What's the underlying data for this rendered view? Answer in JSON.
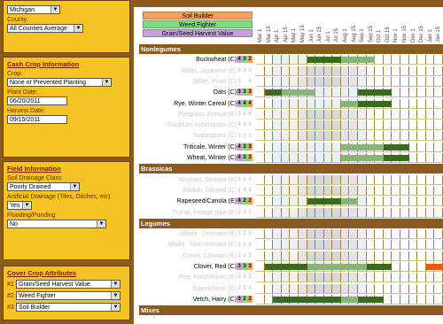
{
  "left": {
    "state": "Michigan",
    "county_label": "County:",
    "county": "All Counties Average",
    "cash_crop_title": "Cash Crop Information",
    "crop_label": "Crop:",
    "crop": "None or Prevented Planting",
    "plant_date_label": "Plant Date:",
    "plant_date": "06/20/2011",
    "harvest_date_label": "Harvest Date:",
    "harvest_date": "09/15/2011",
    "field_title": "Field Information",
    "drainage_class_label": "Soil Drainage Class",
    "drainage_class": "Poorly Drained",
    "artificial_label": "Artificial Drainage (Tiles, Ditches, etc)",
    "artificial": "Yes",
    "flooding_label": "Flooding/Ponding",
    "flooding": "No",
    "cover_title": "Cover Crop Attributes",
    "attr": [
      {
        "num": "#1",
        "value": "Grain/Seed Harvest Value"
      },
      {
        "num": "#2",
        "value": "Weed Fighter"
      },
      {
        "num": "#3",
        "value": "Soil Builder"
      }
    ]
  },
  "legend": [
    {
      "label": "Soil Builder",
      "color": "#f7a35c"
    },
    {
      "label": "Weed Fighter",
      "color": "#7be07b"
    },
    {
      "label": "Grain/Seed Harvest Value",
      "color": "#c9a0dc"
    }
  ],
  "months": [
    "Mar 1",
    "Mar 15",
    "Apr 1",
    "Apr 15",
    "May 1",
    "May 15",
    "Jun 1",
    "Jun 15",
    "Jul 1",
    "Jul 15",
    "Aug 1",
    "Aug 15",
    "Sep 1",
    "Sep 15",
    "Oct 1",
    "Oct 15",
    "Nov 1",
    "Nov 15",
    "Dec 1",
    "Dec 15",
    "Jan 1",
    "Jan 15"
  ],
  "rows": [
    {
      "type": "cat",
      "name": "Nonlegumes"
    },
    {
      "type": "crop",
      "name": "Buckwheat (C)",
      "r": [
        "4",
        "3",
        "2"
      ],
      "dim": false,
      "bars": [
        [
          6,
          10,
          "#3a6b1a"
        ],
        [
          10,
          14,
          "#88b478"
        ]
      ]
    },
    {
      "type": "crop",
      "name": "Millet, Japanese (E)",
      "r": [
        "4",
        "4",
        "3"
      ],
      "dim": true,
      "bars": []
    },
    {
      "type": "crop",
      "name": "Millet, Pearl (C)",
      "r": [
        "3",
        "",
        "4"
      ],
      "dim": true,
      "bars": []
    },
    {
      "type": "crop",
      "name": "Oats (C)",
      "r": [
        "3",
        "3",
        "3"
      ],
      "dim": false,
      "bars": [
        [
          1,
          3,
          "#3a6b1a"
        ],
        [
          3,
          7,
          "#88b478"
        ],
        [
          12,
          16,
          "#3a6b1a"
        ]
      ]
    },
    {
      "type": "crop",
      "name": "Rye, Winter Cereal (C)",
      "r": [
        "4",
        "4",
        "4"
      ],
      "dim": false,
      "bars": [
        [
          10,
          12,
          "#88b478"
        ],
        [
          12,
          16,
          "#3a6b1a"
        ]
      ]
    },
    {
      "type": "crop",
      "name": "Ryegrass, Annual (E)",
      "r": [
        "3",
        "3",
        "4"
      ],
      "dim": true,
      "bars": []
    },
    {
      "type": "crop",
      "name": "Sorghum-sudangrass (C)",
      "r": [
        "4",
        "4",
        "4"
      ],
      "dim": true,
      "bars": []
    },
    {
      "type": "crop",
      "name": "Sudangrass (C)",
      "r": [
        "3",
        "3",
        "3"
      ],
      "dim": true,
      "bars": []
    },
    {
      "type": "crop",
      "name": "Triticale, Winter (C)",
      "r": [
        "4",
        "3",
        "3"
      ],
      "dim": false,
      "bars": [
        [
          10,
          15,
          "#88b478"
        ],
        [
          15,
          18,
          "#3a6b1a"
        ]
      ]
    },
    {
      "type": "crop",
      "name": "Wheat, Winter (C)",
      "r": [
        "4",
        "3",
        "3"
      ],
      "dim": false,
      "bars": [
        [
          10,
          15,
          "#88b478"
        ],
        [
          15,
          18,
          "#3a6b1a"
        ]
      ]
    },
    {
      "type": "cat",
      "name": "Brassicas"
    },
    {
      "type": "crop",
      "name": "Mustard, Oriental (E)",
      "r": [
        "3",
        "2",
        "3"
      ],
      "dim": true,
      "bars": []
    },
    {
      "type": "crop",
      "name": "Radish, Oilseed (C)",
      "r": [
        "2",
        "4",
        "3"
      ],
      "dim": true,
      "bars": []
    },
    {
      "type": "crop",
      "name": "Rapeseed/Canola (E)",
      "r": [
        "4",
        "2",
        "2"
      ],
      "dim": false,
      "bars": [
        [
          6,
          10,
          "#3a6b1a"
        ],
        [
          10,
          12,
          "#88b478"
        ]
      ]
    },
    {
      "type": "crop",
      "name": "Turnip, Forage type (E)",
      "r": [
        "2",
        "3",
        "3"
      ],
      "dim": true,
      "bars": []
    },
    {
      "type": "cat",
      "name": "Legumes"
    },
    {
      "type": "crop",
      "name": "Alfalfa - Dormant (E)",
      "r": [
        "3",
        "2",
        "3"
      ],
      "dim": true,
      "bars": []
    },
    {
      "type": "crop",
      "name": "Alfalfa - Non-dormant (E)",
      "r": [
        "3",
        "2",
        "3"
      ],
      "dim": true,
      "bars": []
    },
    {
      "type": "crop",
      "name": "Clover, Crimson (E)",
      "r": [
        "3",
        "2",
        "3"
      ],
      "dim": true,
      "bars": []
    },
    {
      "type": "crop",
      "name": "Clover, Red (C)",
      "r": [
        "3",
        "3",
        "3"
      ],
      "dim": false,
      "bars": [
        [
          1,
          6,
          "#3a6b1a"
        ],
        [
          6,
          13,
          "#88b478"
        ],
        [
          13,
          16,
          "#3a6b1a"
        ],
        [
          20,
          22,
          "#e85a1a"
        ]
      ]
    },
    {
      "type": "crop",
      "name": "Pea, Field/Winter (E)",
      "r": [
        "2",
        "3",
        "3"
      ],
      "dim": true,
      "bars": []
    },
    {
      "type": "crop",
      "name": "Sweetclover (C)",
      "r": [
        "3",
        "2",
        "3"
      ],
      "dim": true,
      "bars": []
    },
    {
      "type": "crop",
      "name": "Vetch, Hairy (C)",
      "r": [
        "3",
        "2",
        "2"
      ],
      "dim": false,
      "bars": [
        [
          2,
          10,
          "#3a6b1a"
        ],
        [
          10,
          12,
          "#88b478"
        ],
        [
          12,
          15,
          "#3a6b1a"
        ]
      ]
    },
    {
      "type": "cat",
      "name": "Mixes"
    }
  ]
}
